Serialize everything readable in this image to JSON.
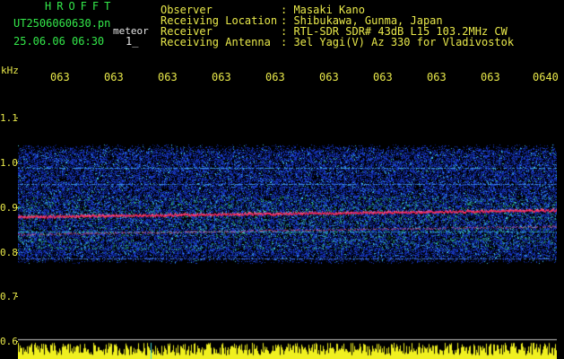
{
  "header": {
    "brand": "HROFFT",
    "filename": "UT2506060630.pn",
    "detector": "meteor",
    "timestamp": "25.06.06 06:30",
    "index": "1_",
    "fields": [
      {
        "label": "Observer",
        "value": ": Masaki Kano"
      },
      {
        "label": "Receiving Location",
        "value": ": Shibukawa, Gunma, Japan"
      },
      {
        "label": "Receiver",
        "value": ": RTL-SDR SDR# 43dB L15 103.2MHz CW"
      },
      {
        "label": "Receiving Antenna",
        "value": ": 3el Yagi(V) Az 330 for Vladivostok"
      }
    ]
  },
  "axis": {
    "y_unit": "kHz",
    "y_labels": [
      "1.1",
      "1.0",
      "0.9",
      "0.8",
      "0.7",
      "0.6"
    ],
    "x_labels": [
      "063",
      "063",
      "063",
      "063",
      "063",
      "063",
      "063",
      "063",
      "063",
      "0640"
    ]
  },
  "colors": {
    "label_green": "#33e84a",
    "label_white": "#e6e6e6",
    "axis_yellow": "#e8e84a",
    "background": "#000000",
    "echo_red": "#ff2a5a",
    "noise_blue": "#1a3ccc",
    "noise_cyan": "#3fc8e0",
    "level_yellow": "#f0f020"
  }
}
